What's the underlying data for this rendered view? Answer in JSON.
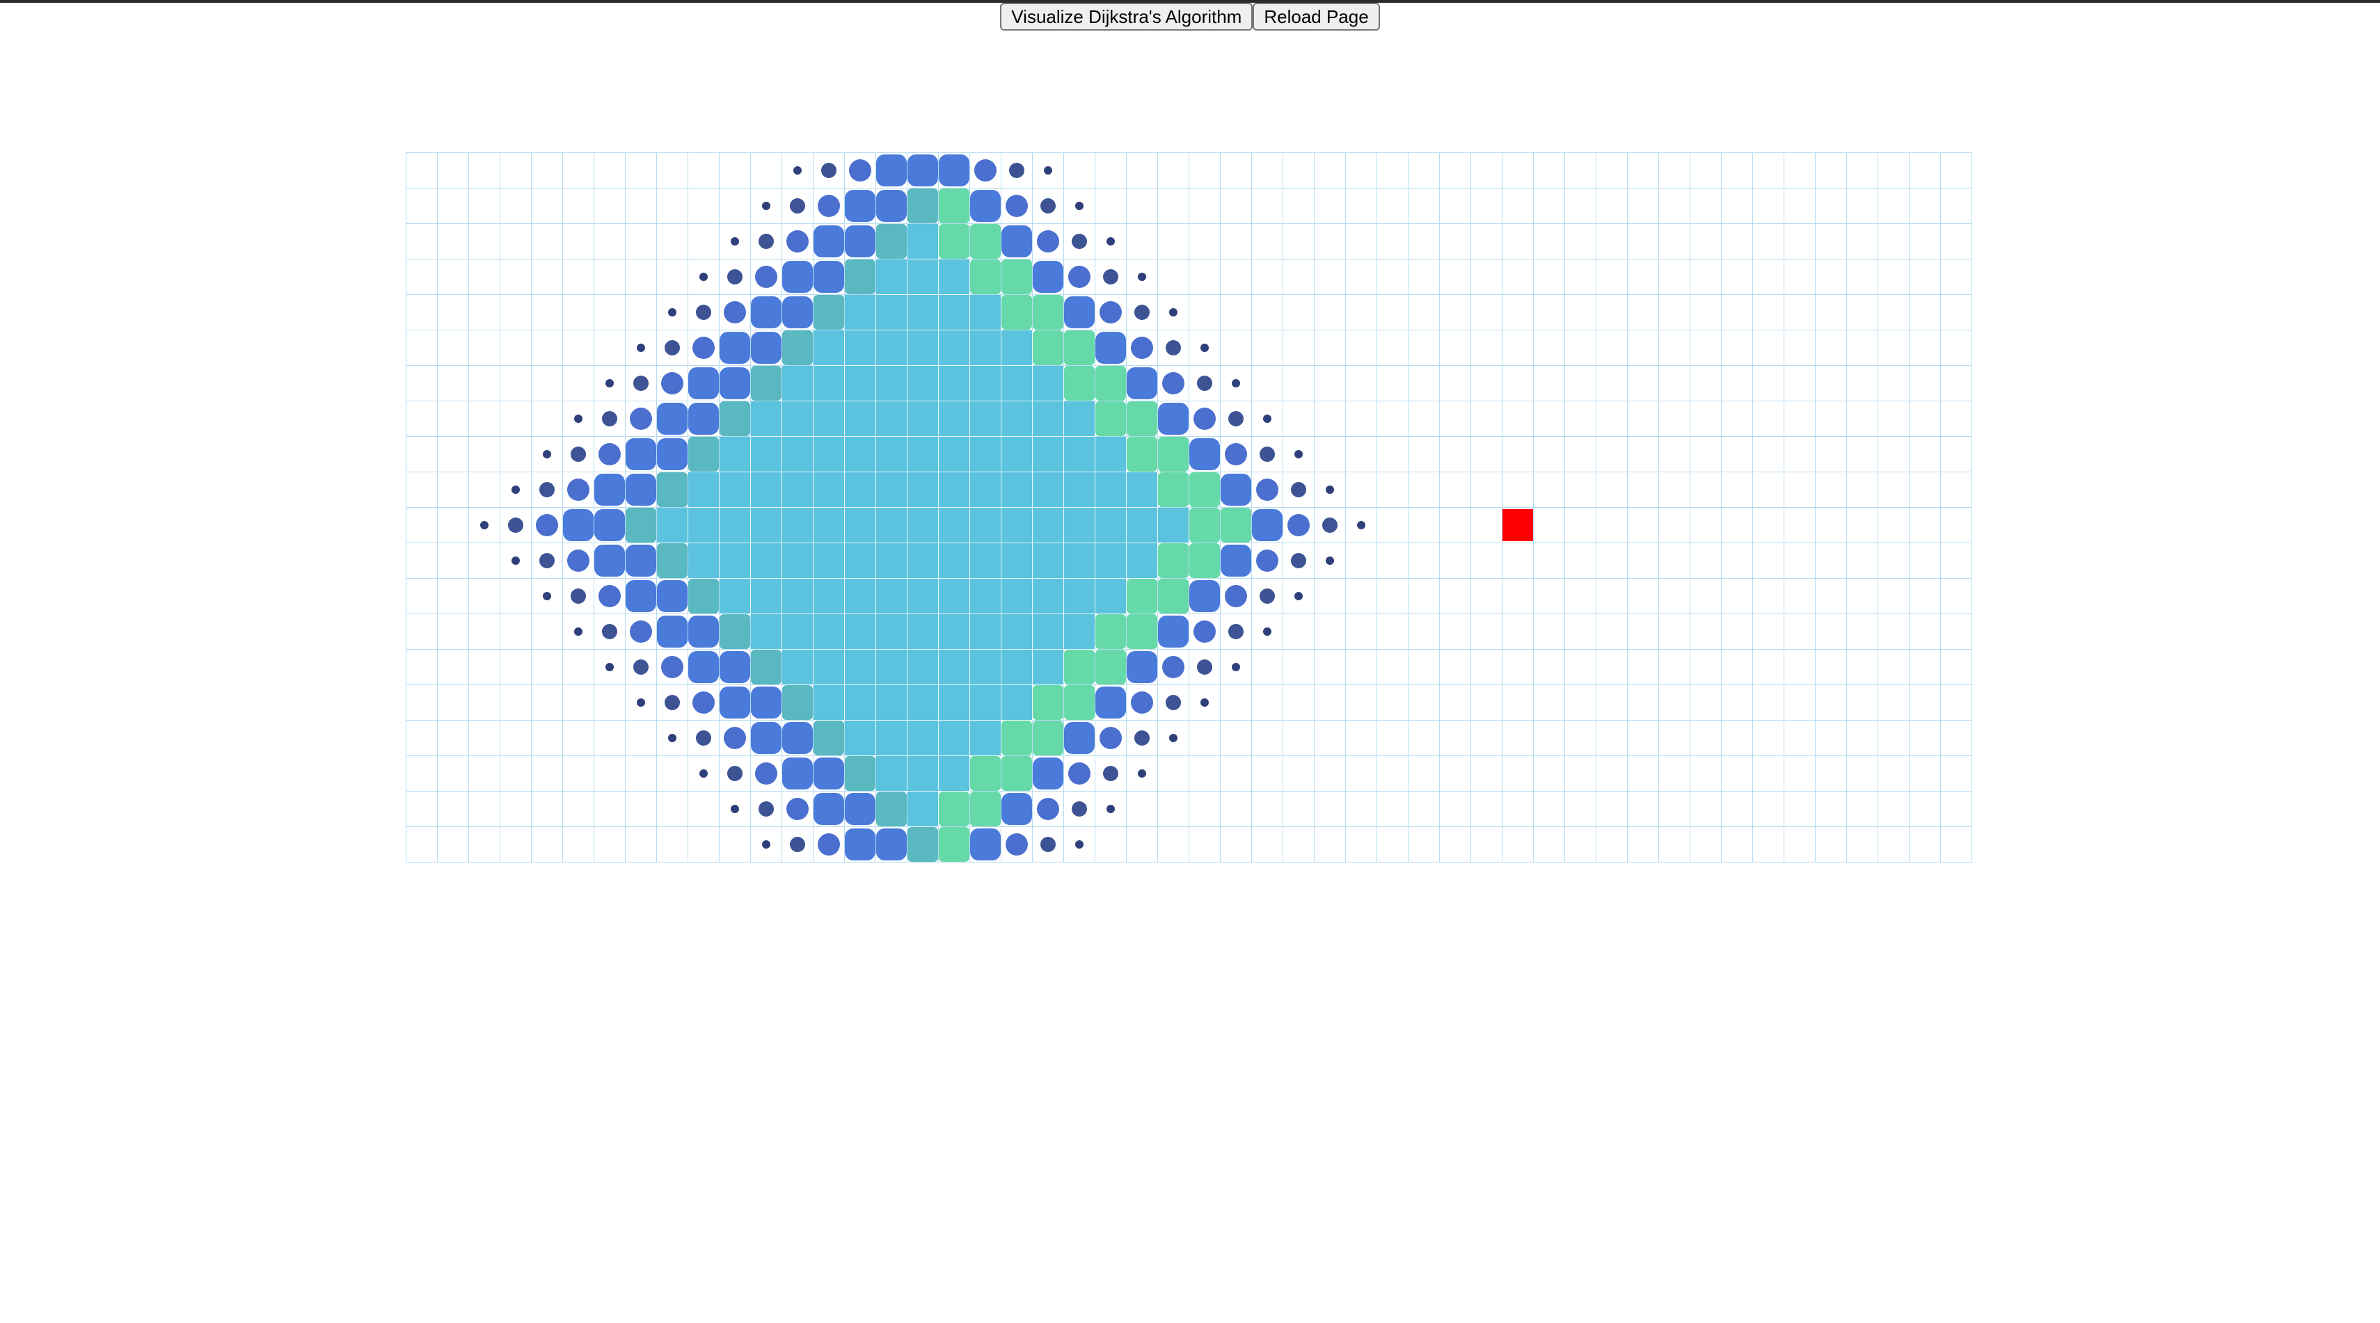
{
  "toolbar": {
    "visualize_label": "Visualize Dijkstra's Algorithm",
    "reload_label": "Reload Page"
  },
  "grid": {
    "rows": 20,
    "cols": 50,
    "start": {
      "row": 10,
      "col": 16
    },
    "target": {
      "row": 10,
      "col": 35
    },
    "colors": {
      "visited": "#5cc3de",
      "frontier_teal": "#66d9a8",
      "frontier_blue": "#4a7bdb",
      "dot_big": "#4a6fcf",
      "dot_small": "#3d5394",
      "target": "#ff0000",
      "grid_line": "#b5dcf2"
    }
  }
}
